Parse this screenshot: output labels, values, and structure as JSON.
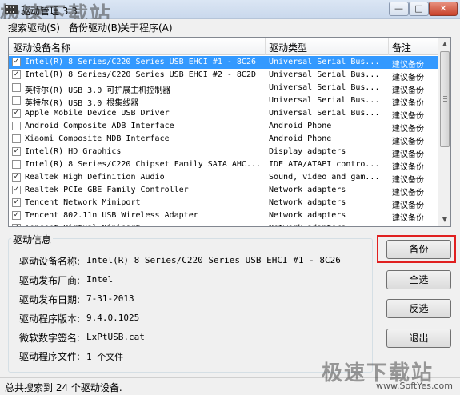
{
  "window": {
    "title": "驱动管理 3.3"
  },
  "watermark": {
    "top": "极速下载站",
    "bottom": "极速下载站",
    "url": "www.SoftYes.com"
  },
  "menu": {
    "items": [
      "搜索驱动(S)",
      "备份驱动(B)",
      "关于程序(A)"
    ]
  },
  "list": {
    "columns": [
      "驱动设备名称",
      "驱动类型",
      "备注"
    ],
    "rows": [
      {
        "checked": true,
        "name": "Intel(R) 8 Series/C220 Series USB EHCI #1 - 8C26",
        "type": "Universal Serial Bus...",
        "note": "建议备份",
        "selected": true
      },
      {
        "checked": true,
        "name": "Intel(R) 8 Series/C220 Series USB EHCI #2 - 8C2D",
        "type": "Universal Serial Bus...",
        "note": "建议备份"
      },
      {
        "checked": false,
        "name": "英特尔(R) USB 3.0 可扩展主机控制器",
        "type": "Universal Serial Bus...",
        "note": "建议备份"
      },
      {
        "checked": false,
        "name": "英特尔(R) USB 3.0 根集线器",
        "type": "Universal Serial Bus...",
        "note": "建议备份"
      },
      {
        "checked": true,
        "name": "Apple Mobile Device USB Driver",
        "type": "Universal Serial Bus...",
        "note": "建议备份"
      },
      {
        "checked": false,
        "name": "Android Composite ADB Interface",
        "type": "Android Phone",
        "note": "建议备份"
      },
      {
        "checked": false,
        "name": "Xiaomi Composite MDB Interface",
        "type": "Android Phone",
        "note": "建议备份"
      },
      {
        "checked": true,
        "name": "Intel(R) HD Graphics",
        "type": "Display adapters",
        "note": "建议备份"
      },
      {
        "checked": false,
        "name": "Intel(R) 8 Series/C220 Chipset Family SATA AHC...",
        "type": "IDE ATA/ATAPI contro...",
        "note": "建议备份"
      },
      {
        "checked": true,
        "name": "Realtek High Definition Audio",
        "type": "Sound, video and gam...",
        "note": "建议备份"
      },
      {
        "checked": true,
        "name": "Realtek PCIe GBE Family Controller",
        "type": "Network adapters",
        "note": "建议备份"
      },
      {
        "checked": true,
        "name": "Tencent Network Miniport",
        "type": "Network adapters",
        "note": "建议备份"
      },
      {
        "checked": true,
        "name": "Tencent 802.11n USB Wireless Adapter",
        "type": "Network adapters",
        "note": "建议备份"
      },
      {
        "checked": true,
        "name": "Tencent Virtual Miniport",
        "type": "Network adapters",
        "note": "建议备份"
      }
    ]
  },
  "info": {
    "title": "驱动信息",
    "fields": [
      {
        "label": "驱动设备名称:",
        "value": "Intel(R) 8 Series/C220 Series USB EHCI #1 - 8C26"
      },
      {
        "label": "驱动发布厂商:",
        "value": "Intel"
      },
      {
        "label": "驱动发布日期:",
        "value": "7-31-2013"
      },
      {
        "label": "驱动程序版本:",
        "value": "9.4.0.1025"
      },
      {
        "label": "微软数字签名:",
        "value": "LxPtUSB.cat"
      },
      {
        "label": "驱动程序文件:",
        "value": "1 个文件"
      }
    ]
  },
  "buttons": {
    "backup": "备份",
    "select_all": "全选",
    "invert": "反选",
    "exit": "退出"
  },
  "status": {
    "text": "总共搜索到 24 个驱动设备."
  },
  "colors": {
    "selection": "#3399ff",
    "highlight_box": "#e02020"
  }
}
